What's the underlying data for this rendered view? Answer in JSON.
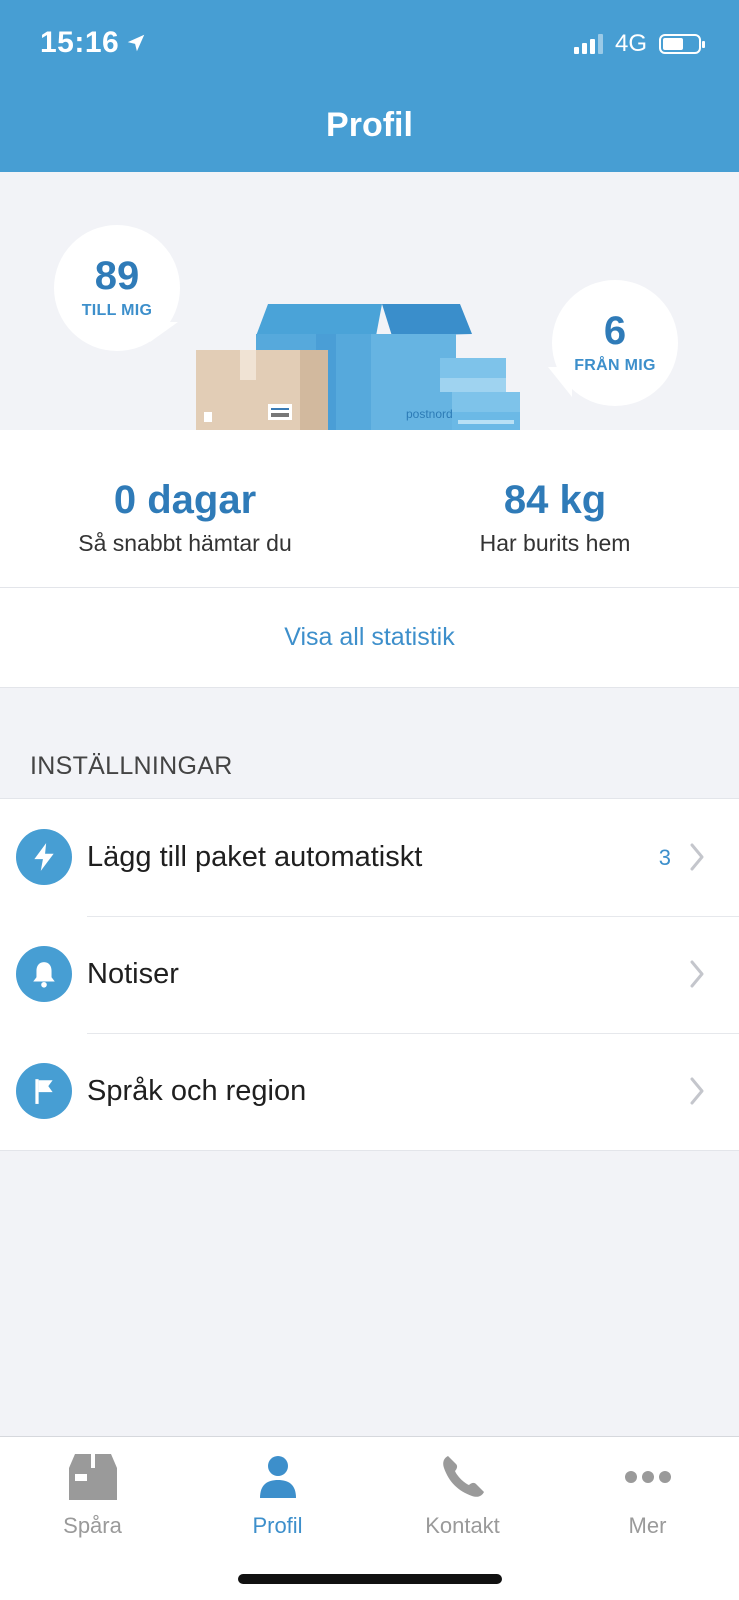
{
  "status_bar": {
    "time": "15:16",
    "network": "4G"
  },
  "header": {
    "title": "Profil"
  },
  "hero": {
    "to_me": {
      "count": "89",
      "label": "TILL MIG"
    },
    "from_me": {
      "count": "6",
      "label": "FRÅN MIG"
    },
    "box_brand": "postnord"
  },
  "stats": {
    "pickup": {
      "value": "0 dagar",
      "caption": "Så snabbt hämtar du"
    },
    "weight": {
      "value": "84 kg",
      "caption": "Har burits hem"
    }
  },
  "show_all_label": "Visa all statistik",
  "settings": {
    "title": "INSTÄLLNINGAR",
    "items": [
      {
        "label": "Lägg till paket automatiskt",
        "count": "3",
        "icon": "bolt-icon"
      },
      {
        "label": "Notiser",
        "count": "",
        "icon": "bell-icon"
      },
      {
        "label": "Språk och region",
        "count": "",
        "icon": "flag-icon"
      }
    ]
  },
  "tabbar": {
    "active": "Profil",
    "tabs": [
      {
        "label": "Spåra",
        "icon": "package-icon"
      },
      {
        "label": "Profil",
        "icon": "person-icon"
      },
      {
        "label": "Kontakt",
        "icon": "phone-icon"
      },
      {
        "label": "Mer",
        "icon": "more-icon"
      }
    ]
  },
  "colors": {
    "primary": "#479ed3",
    "accent_text": "#2f7bb8",
    "background": "#f2f3f7"
  }
}
